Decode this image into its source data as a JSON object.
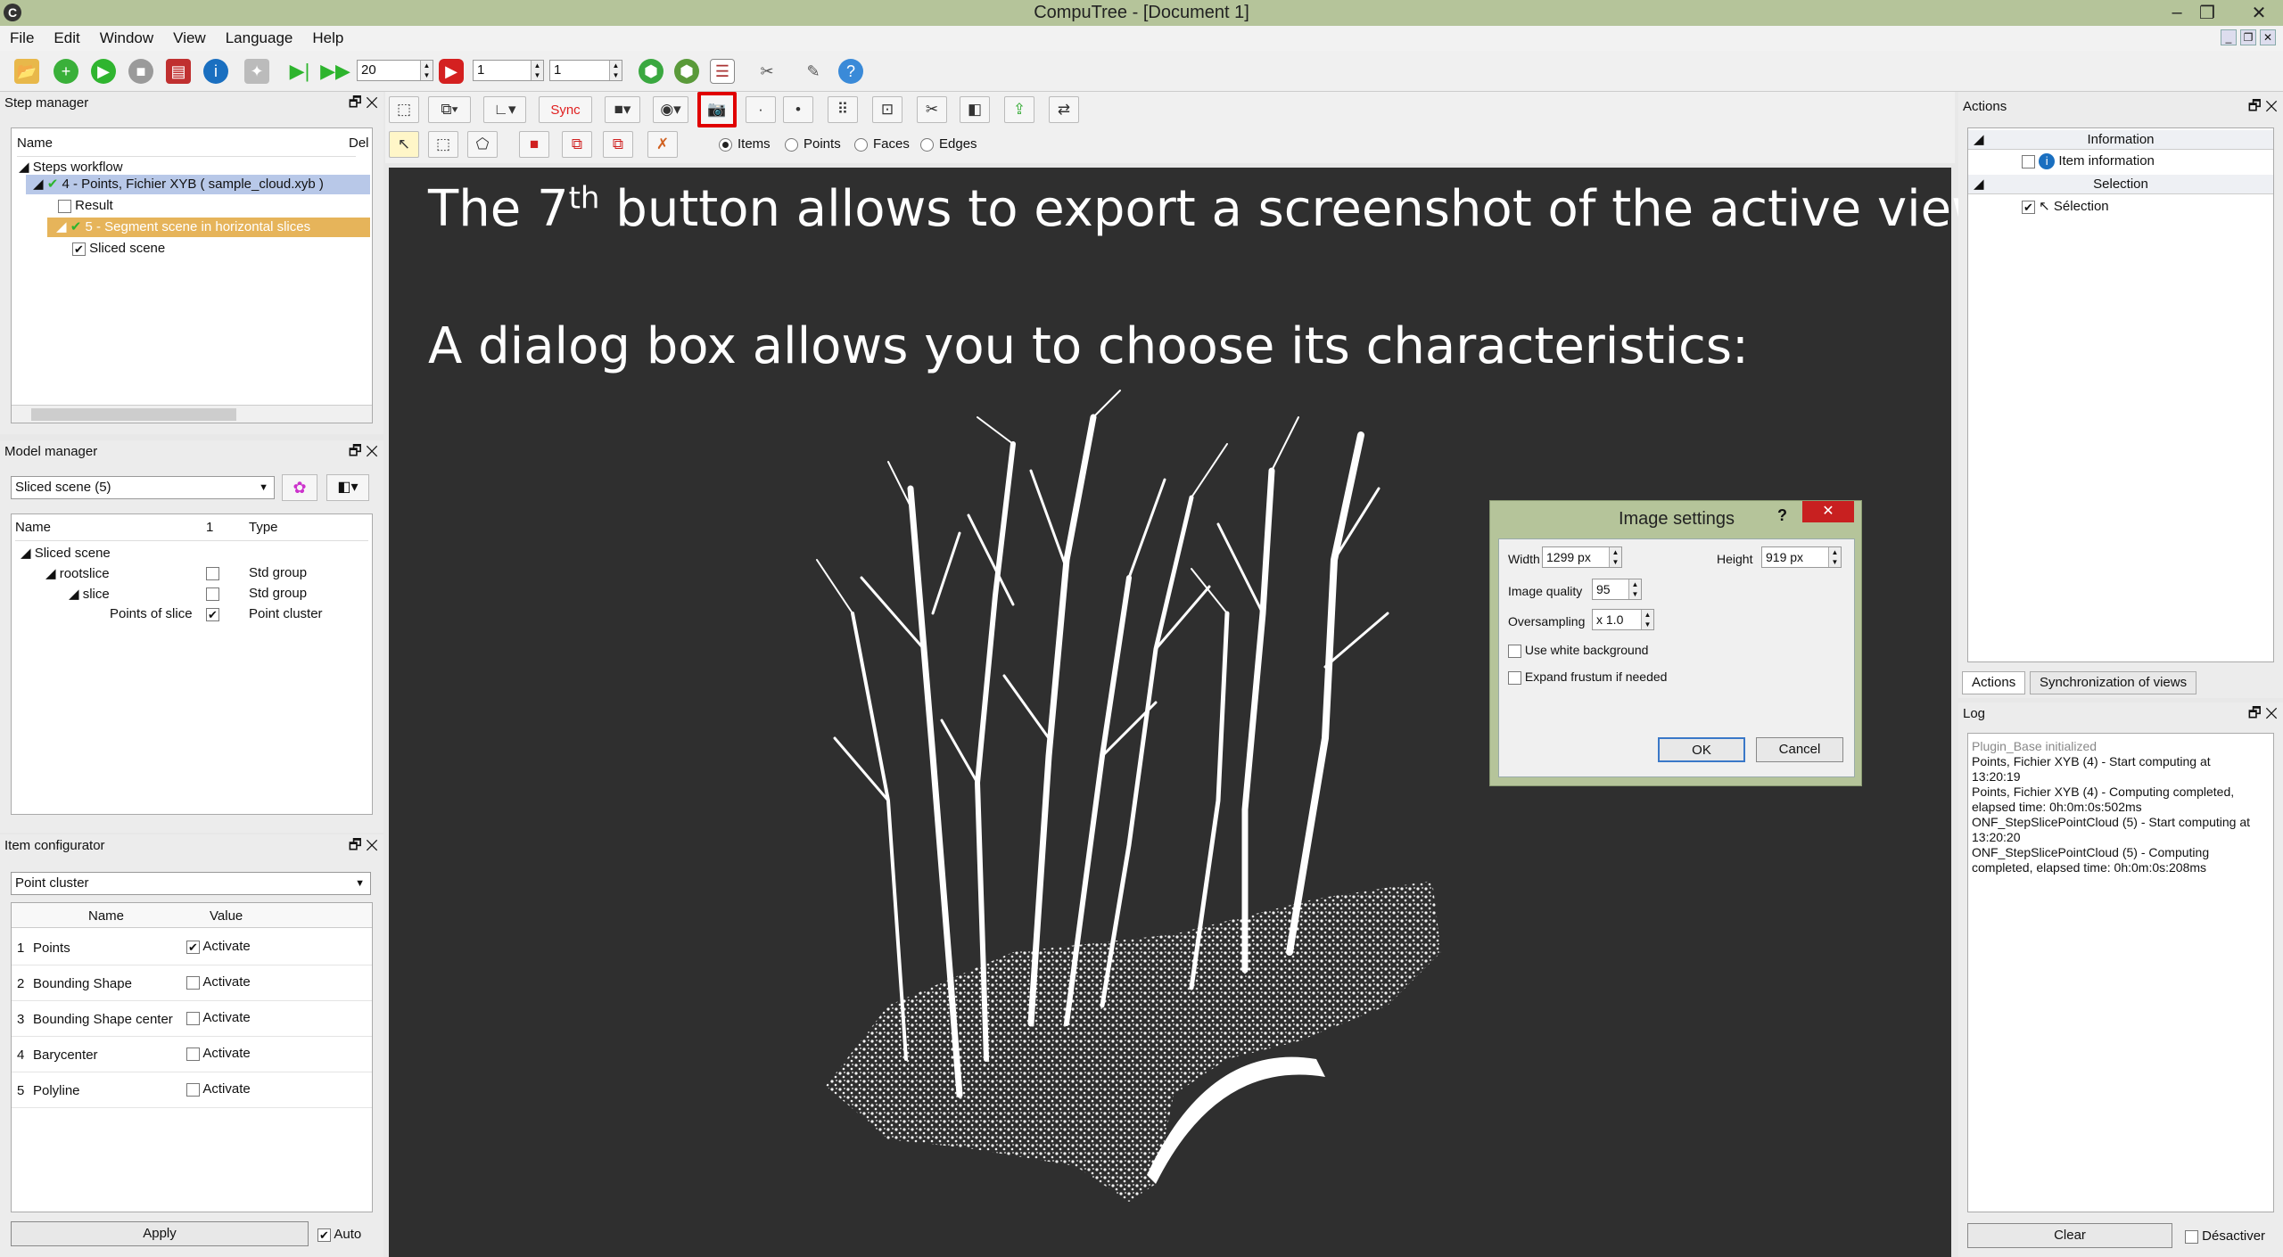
{
  "window": {
    "title": "CompuTree - [Document 1]",
    "app_icon": "C"
  },
  "menu": [
    "File",
    "Edit",
    "Window",
    "View",
    "Language",
    "Help"
  ],
  "toolbar": {
    "steps_value": "20",
    "spin_a": "1",
    "spin_b": "1"
  },
  "step_manager": {
    "title": "Step manager",
    "col_name": "Name",
    "col_debug": "Del",
    "items": [
      {
        "label": "Steps workflow"
      },
      {
        "label": "4 - Points, Fichier XYB ( sample_cloud.xyb )"
      },
      {
        "label": "Result"
      },
      {
        "label": "5 - Segment scene in horizontal slices"
      },
      {
        "label": "Sliced scene"
      }
    ]
  },
  "model_manager": {
    "title": "Model manager",
    "selected": "Sliced scene (5)",
    "col_name": "Name",
    "col_1": "1",
    "col_type": "Type",
    "items": [
      {
        "name": "Sliced scene",
        "type": ""
      },
      {
        "name": "rootslice",
        "type": "Std group"
      },
      {
        "name": "slice",
        "type": "Std group"
      },
      {
        "name": "Points of slice",
        "type": "Point cluster"
      }
    ]
  },
  "item_configurator": {
    "title": "Item configurator",
    "selected": "Point cluster",
    "col_name": "Name",
    "col_value": "Value",
    "rows": [
      {
        "n": "1",
        "name": "Points",
        "value": "Activate",
        "checked": true
      },
      {
        "n": "2",
        "name": "Bounding Shape",
        "value": "Activate",
        "checked": false
      },
      {
        "n": "3",
        "name": "Bounding Shape center",
        "value": "Activate",
        "checked": false
      },
      {
        "n": "4",
        "name": "Barycenter",
        "value": "Activate",
        "checked": false
      },
      {
        "n": "5",
        "name": "Polyline",
        "value": "Activate",
        "checked": false
      }
    ],
    "apply": "Apply",
    "auto": "Auto"
  },
  "viewer": {
    "sync": "Sync",
    "radios": [
      "Items",
      "Points",
      "Faces",
      "Edges"
    ],
    "caption1_pre": "The 7",
    "caption1_sup": "th",
    "caption1_post": " button allows to export a screenshot of the active view.",
    "caption2": "A dialog box allows you to choose its characteristics:"
  },
  "image_settings": {
    "title": "Image settings",
    "help": "?",
    "width_label": "Width",
    "width_value": "1299 px",
    "height_label": "Height",
    "height_value": "919 px",
    "quality_label": "Image quality",
    "quality_value": "95",
    "oversampling_label": "Oversampling",
    "oversampling_value": "x 1.0",
    "white_bg": "Use white background",
    "expand": "Expand frustum if needed",
    "ok": "OK",
    "cancel": "Cancel"
  },
  "actions": {
    "title": "Actions",
    "group1": "Information",
    "item1": "Item information",
    "group2": "Selection",
    "item2": "Sélection",
    "tab1": "Actions",
    "tab2": "Synchronization of views"
  },
  "log": {
    "title": "Log",
    "lines": [
      "Plugin_Base initialized",
      "Points, Fichier XYB (4) - Start computing at",
      "13:20:19",
      "Points, Fichier XYB (4) - Computing completed,",
      "elapsed time: 0h:0m:0s:502ms",
      "ONF_StepSlicePointCloud (5) - Start computing at",
      "13:20:20",
      "ONF_StepSlicePointCloud (5) - Computing",
      "completed, elapsed time: 0h:0m:0s:208ms"
    ],
    "clear": "Clear",
    "disable": "Désactiver"
  },
  "colors": {
    "titlebar": "#b5c49a",
    "view_bg": "#2f2f2f",
    "highlight": "#e00000"
  }
}
